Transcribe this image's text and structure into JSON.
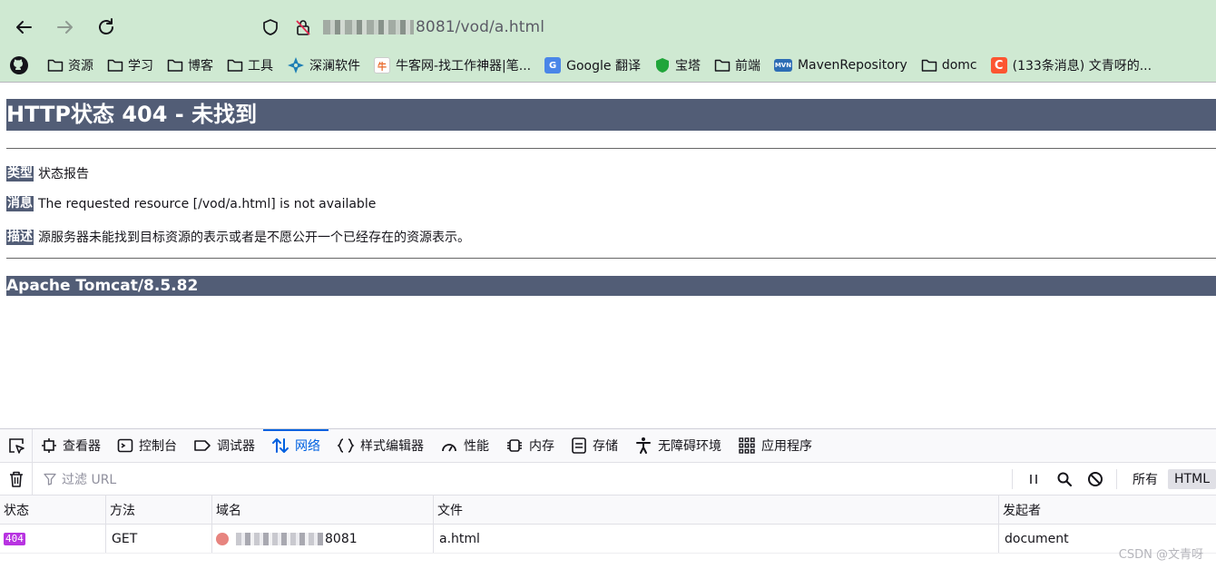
{
  "browser": {
    "url_suffix": "8081/vod/a.html"
  },
  "bookmarks": [
    {
      "label": "资源",
      "icon": "folder-icon"
    },
    {
      "label": "学习",
      "icon": "folder-icon"
    },
    {
      "label": "博客",
      "icon": "folder-icon"
    },
    {
      "label": "工具",
      "icon": "folder-icon"
    },
    {
      "label": "深澜软件",
      "icon": "compass-icon"
    },
    {
      "label": "牛客网-找工作神器|笔...",
      "icon": "nowcoder-icon"
    },
    {
      "label": "Google 翻译",
      "icon": "google-translate-icon"
    },
    {
      "label": "宝塔",
      "icon": "baota-icon"
    },
    {
      "label": "前端",
      "icon": "folder-icon"
    },
    {
      "label": "MavenRepository",
      "icon": "maven-icon"
    },
    {
      "label": "domc",
      "icon": "folder-icon"
    },
    {
      "label": "(133条消息) 文青呀的...",
      "icon": "csdn-icon"
    }
  ],
  "page": {
    "heading": "HTTP状态 404 - 未找到",
    "type_label": "类型",
    "type_value": "状态报告",
    "message_label": "消息",
    "message_value": "The requested resource [/vod/a.html] is not available",
    "description_label": "描述",
    "description_value": "源服务器未能找到目标资源的表示或者是不愿公开一个已经存在的资源表示。",
    "footer": "Apache Tomcat/8.5.82"
  },
  "devtools": {
    "tabs": [
      {
        "label": "查看器",
        "icon": "inspector-icon"
      },
      {
        "label": "控制台",
        "icon": "console-icon"
      },
      {
        "label": "调试器",
        "icon": "debugger-icon"
      },
      {
        "label": "网络",
        "icon": "network-icon",
        "active": true
      },
      {
        "label": "样式编辑器",
        "icon": "style-editor-icon"
      },
      {
        "label": "性能",
        "icon": "performance-icon"
      },
      {
        "label": "内存",
        "icon": "memory-icon"
      },
      {
        "label": "存储",
        "icon": "storage-icon"
      },
      {
        "label": "无障碍环境",
        "icon": "accessibility-icon"
      },
      {
        "label": "应用程序",
        "icon": "application-icon"
      }
    ],
    "filter_placeholder": "过滤 URL",
    "type_filters": [
      "所有",
      "HTML"
    ],
    "selected_type_filter": "HTML",
    "columns": [
      "状态",
      "方法",
      "域名",
      "文件",
      "发起者"
    ],
    "rows": [
      {
        "status": "404",
        "method": "GET",
        "domain_suffix": "8081",
        "file": "a.html",
        "initiator": "document"
      }
    ]
  },
  "watermark": "CSDN @文青呀",
  "colors": {
    "toolbar_bg": "#cfe9d2",
    "tomcat_header": "#525d76",
    "active_tab": "#0061e0",
    "status_404": "#b833e1"
  }
}
